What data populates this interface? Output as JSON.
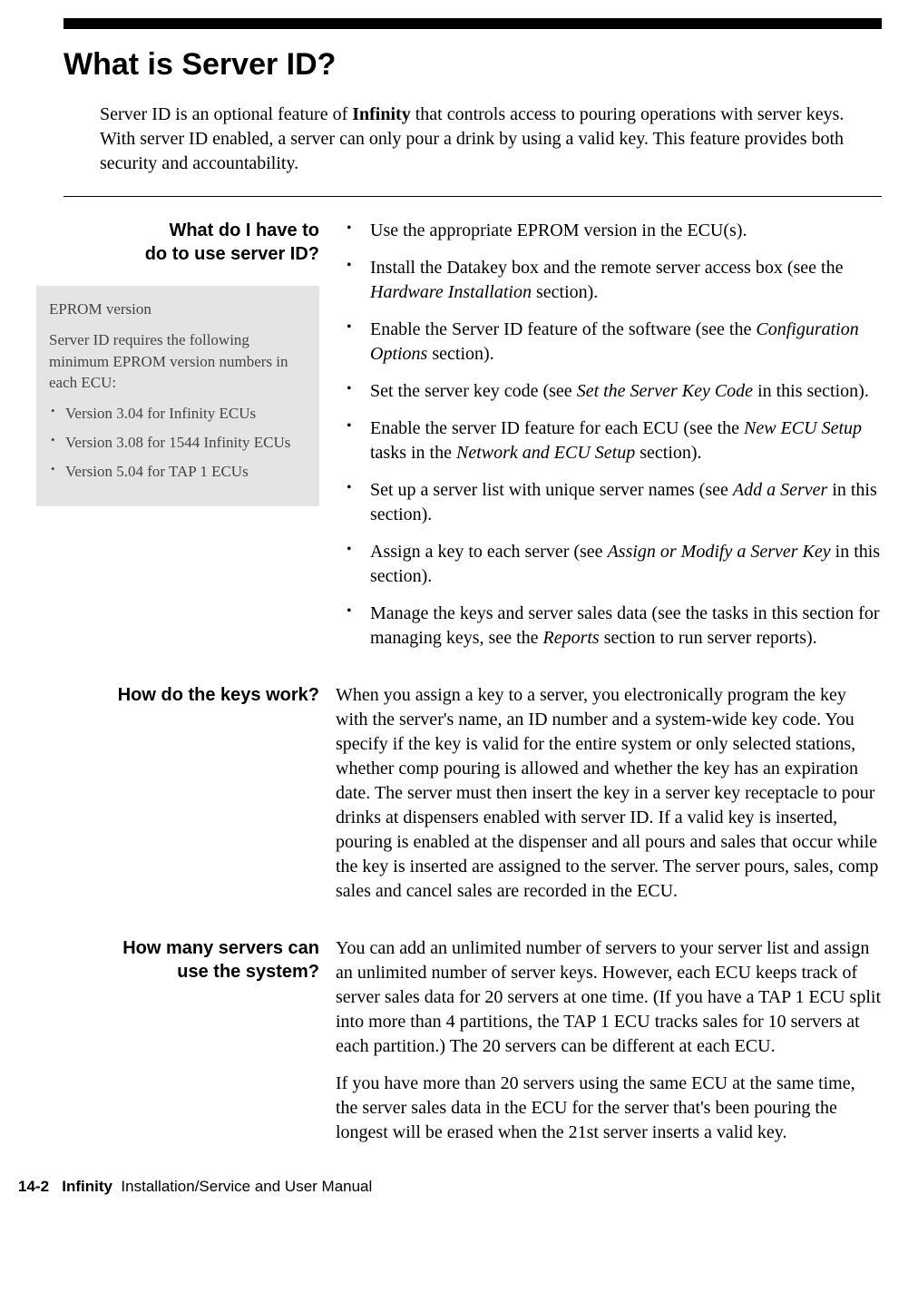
{
  "page_title": "What is Server ID?",
  "intro_pre": "Server ID is an optional feature of ",
  "intro_bold": "Infinity",
  "intro_post": " that controls access to pouring operations with server keys. With server ID enabled, a server can only pour a drink by using a valid key. This feature provides both security and accountability.",
  "section1": {
    "heading_line1": "What do I have to",
    "heading_line2": "do to use server ID?",
    "bullets": [
      {
        "pre": "Use the appropriate EPROM version in the ECU(s).",
        "it1": "",
        "mid1": "",
        "it2": "",
        "post": ""
      },
      {
        "pre": "Install the Datakey box and the remote server access box (see the ",
        "it1": "Hardware Installation",
        "mid1": " section).",
        "it2": "",
        "post": ""
      },
      {
        "pre": "Enable the Server ID feature of the software (see the ",
        "it1": "Configuration Options",
        "mid1": " section).",
        "it2": "",
        "post": ""
      },
      {
        "pre": "Set the server key code (see ",
        "it1": "Set the Server Key Code",
        "mid1": " in this section).",
        "it2": "",
        "post": ""
      },
      {
        "pre": "Enable the server ID feature for each ECU (see the ",
        "it1": "New ECU Setup",
        "mid1": " tasks in the ",
        "it2": "Network and ECU Setup",
        "post": " section)."
      },
      {
        "pre": "Set up a server list with unique server names (see ",
        "it1": "Add a Server",
        "mid1": " in this section).",
        "it2": "",
        "post": ""
      },
      {
        "pre": "Assign a key to each server (see ",
        "it1": "Assign or Modify a Server Key",
        "mid1": " in this section).",
        "it2": "",
        "post": ""
      },
      {
        "pre": "Manage the keys and server sales data (see the tasks in this section for managing keys, see the ",
        "it1": "Reports",
        "mid1": " section to run server reports).",
        "it2": "",
        "post": ""
      }
    ]
  },
  "sidebox": {
    "title": "EPROM version",
    "text": "Server ID requires the following minimum EPROM version numbers in each ECU:",
    "items": [
      "Version 3.04 for Infinity ECUs",
      "Version 3.08 for 1544 Infinity ECUs",
      "Version 5.04 for TAP 1 ECUs"
    ]
  },
  "section2": {
    "heading": "How do the keys work?",
    "para": "When you assign a key to a server, you electronically program the key with the server's name, an ID number and a system-wide key code. You specify if the key is valid for the entire system or only selected stations, whether comp pouring is allowed and whether the key has an expiration date. The server must then insert the key in a server key receptacle to pour drinks at dispensers enabled with server ID. If a valid key is inserted, pouring is enabled at the dispenser and all pours and sales that occur while the key is inserted are assigned to the server. The server pours, sales, comp sales and cancel sales are recorded in the ECU."
  },
  "section3": {
    "heading_line1": "How many servers can",
    "heading_line2": "use the system?",
    "para1": "You can add an unlimited number of servers to your server list and assign an unlimited number of server keys. However, each ECU keeps track of server sales data for 20 servers at one time. (If you have a TAP 1 ECU split into more than 4 partitions, the TAP 1 ECU tracks sales for 10 servers at each partition.) The 20 servers can be different at each ECU.",
    "para2": "If you have more than 20 servers using the same ECU at the same time, the server sales data in the ECU for the server that's been pouring the longest will be erased when the 21st server inserts a valid key."
  },
  "footer": {
    "page": "14-2",
    "bold": "Infinity",
    "rest": "Installation/Service and User Manual"
  }
}
